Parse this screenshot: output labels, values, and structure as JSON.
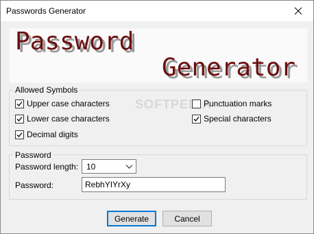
{
  "window": {
    "title": "Passwords Generator",
    "close_icon": "close-icon"
  },
  "banner": {
    "line1": "Password",
    "line2": "Generator",
    "text_color": "#6b0f0f",
    "shadow_color": "#9a9a9a"
  },
  "watermark": "SOFTPEDIA",
  "allowed_symbols": {
    "legend": "Allowed Symbols",
    "options": [
      {
        "label": "Upper case characters",
        "checked": true
      },
      {
        "label": "Lower case characters",
        "checked": true
      },
      {
        "label": "Decimal digits",
        "checked": true
      },
      {
        "label": "Punctuation marks",
        "checked": false
      },
      {
        "label": "Special characters",
        "checked": true
      }
    ]
  },
  "password": {
    "legend": "Password",
    "length_label": "Password length:",
    "length_value": "10",
    "password_label": "Password:",
    "password_value": "RebhYIYrXy"
  },
  "buttons": {
    "generate": "Generate",
    "cancel": "Cancel"
  }
}
